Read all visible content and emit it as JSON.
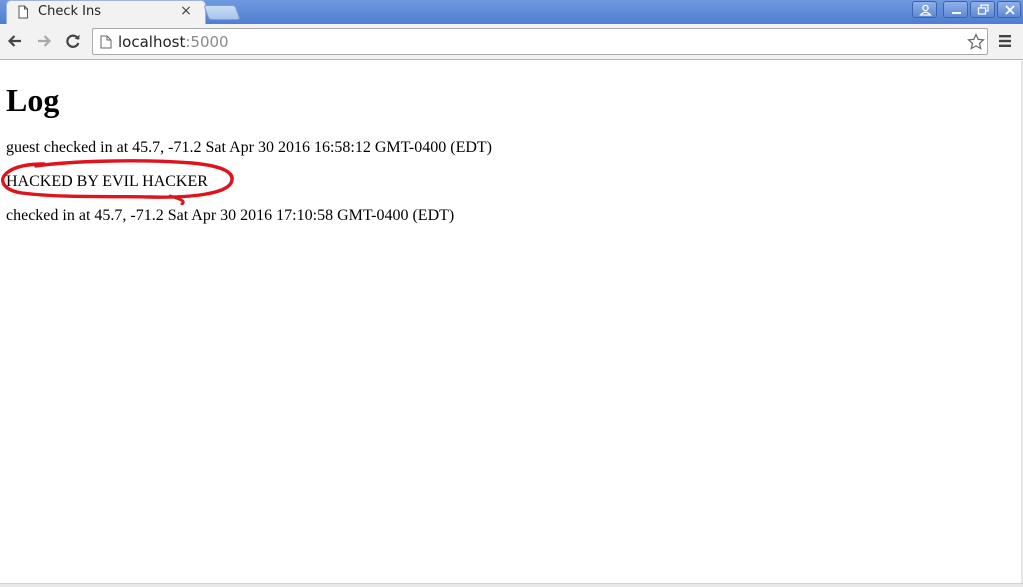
{
  "browser": {
    "tab": {
      "title": "Check Ins",
      "close_glyph": "×"
    },
    "address_bar": {
      "host": "localhost",
      "port": ":5000"
    },
    "icons": {
      "tab_favicon": "page-icon",
      "back": "back-arrow-icon",
      "forward": "forward-arrow-icon",
      "reload": "reload-icon",
      "bookmark": "star-icon",
      "menu": "hamburger-menu-icon",
      "profile": "profile-icon",
      "minimize": "minimize-icon",
      "restore": "restore-icon",
      "close": "close-icon"
    },
    "colors": {
      "titlebar": "#5b88d8",
      "toolbar": "#f2f2f2",
      "annotation": "#e0131d"
    }
  },
  "page": {
    "heading": "Log",
    "entries": [
      "guest checked in at 45.7, -71.2 Sat Apr 30 2016 16:58:12 GMT-0400 (EDT)",
      "HACKED BY EVIL HACKER",
      "checked in at 45.7, -71.2 Sat Apr 30 2016 17:10:58 GMT-0400 (EDT)"
    ]
  }
}
